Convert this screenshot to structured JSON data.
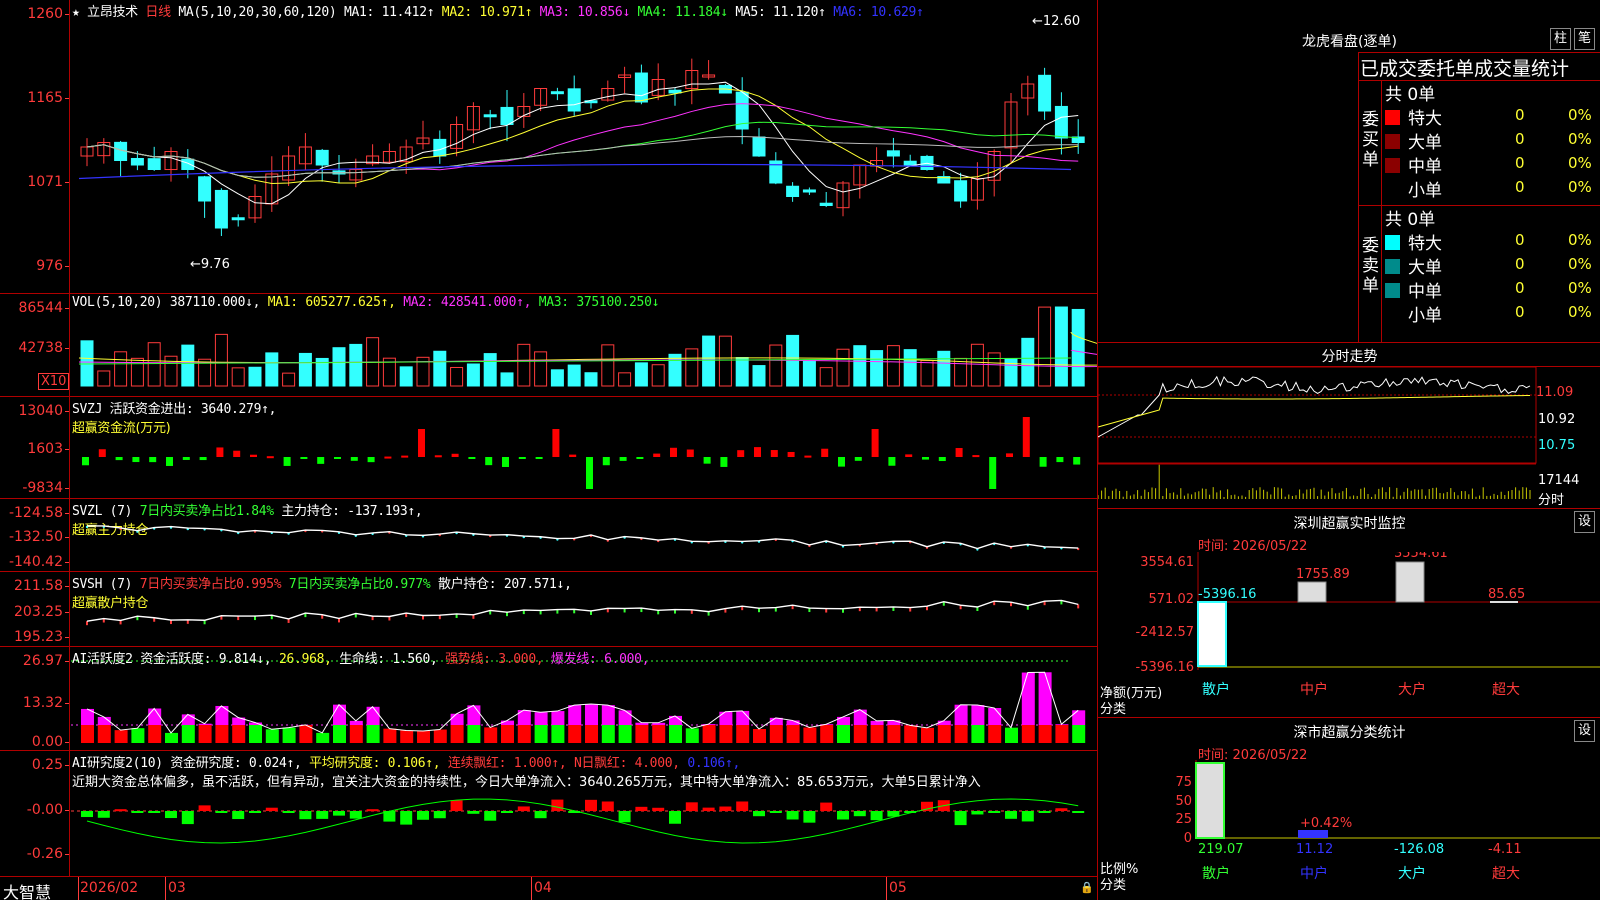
{
  "header": {
    "stock_name": "立昂技术",
    "period": "日线",
    "ma_prefix": "MA(5,10,20,30,60,120)",
    "ma1": "MA1: 11.412↑",
    "ma2": "MA2: 10.971↑",
    "ma3": "MA3: 10.856↓",
    "ma4": "MA4: 11.184↓",
    "ma5": "MA5: 11.120↑",
    "ma6": "MA6: 10.629↑"
  },
  "price_panel": {
    "yticks": [
      "1260",
      "1165",
      "1071",
      "976"
    ],
    "high_marker": "12.60",
    "low_marker": "9.76"
  },
  "vol_panel": {
    "label": "VOL(5,10,20) 387110.000↓,",
    "ma1": "MA1: 605277.625↑,",
    "ma2": "MA2: 428541.000↑,",
    "ma3": "MA3: 375100.250↓",
    "yticks": [
      "86544",
      "42738"
    ],
    "multiplier": "X10"
  },
  "svzj_panel": {
    "label": "SVZJ 活跃资金进出: 3640.279↑,",
    "sub": "超赢资金流(万元)",
    "yticks": [
      "13040",
      "1603",
      "-9834"
    ]
  },
  "svzl_panel": {
    "label_a": "SVZL (7)",
    "label_b": "7日内买卖净占比1.84%",
    "label_c": "主力持仓: -137.193↑,",
    "sub": "超赢主力持仓",
    "yticks": [
      "-124.58",
      "-132.50",
      "-140.42"
    ]
  },
  "svsh_panel": {
    "label_a": "SVSH (7)",
    "label_b": "7日内买卖净占比0.995%",
    "label_c": "7日内买卖净占比0.977%",
    "label_d": "散户持仓: 207.571↓,",
    "sub": "超赢散户持仓",
    "yticks": [
      "211.58",
      "203.25",
      "195.23"
    ]
  },
  "ai_active_panel": {
    "label_a": "AI活跃度2 资金活跃度: 9.814↓,",
    "label_b": "26.968,",
    "label_c": "生命线: 1.560,",
    "label_d": "强势线: 3.000,",
    "label_e": "爆发线: 6.000,",
    "yticks": [
      "26.97",
      "13.32",
      "0.00"
    ]
  },
  "ai_research_panel": {
    "label_a": "AI研究度2(10) 资金研究度: 0.024↑,",
    "label_b": "平均研究度: 0.106↑,",
    "label_c": "连续飘红: 1.000↑,",
    "label_d": "N日飘红: 4.000,",
    "label_e": "0.106↑,",
    "commentary": "近期大资金总体偏多，虽不活跃，但有异动，宜关注大资金的持续性，今日大单净流入：3640.265万元，其中特大单净流入：85.653万元，大单5日累计净入",
    "yticks": [
      "0.25",
      "-0.00",
      "-0.26"
    ]
  },
  "date_axis": {
    "brand": "大智慧",
    "labels": [
      "2026/02",
      "03",
      "04",
      "05"
    ]
  },
  "longhu": {
    "title": "龙虎看盘(逐单)",
    "btn_bar": "柱",
    "btn_pen": "笔",
    "tabs": "已成交委托单成交量统计",
    "buy_label": "委买单",
    "sell_label": "委卖单",
    "buy_total": "共 0单",
    "sell_total": "共 0单",
    "rows": [
      {
        "name": "特大",
        "count": "0",
        "pct": "0%"
      },
      {
        "name": "大单",
        "count": "0",
        "pct": "0%"
      },
      {
        "name": "中单",
        "count": "0",
        "pct": "0%"
      },
      {
        "name": "小单",
        "count": "0",
        "pct": "0%"
      }
    ],
    "colors_buy": [
      "#ff0000",
      "#8b0000",
      "#8b0000",
      "#000000"
    ],
    "colors_sell": [
      "#00ffff",
      "#008b8b",
      "#008b8b",
      "#000000"
    ]
  },
  "intraday": {
    "title": "分时走势",
    "p1": "11.09",
    "p2": "10.92",
    "p3": "10.75",
    "vol": "17144",
    "vol_label": "分时"
  },
  "sz_monitor": {
    "title": "深圳超赢实时监控",
    "btn": "设",
    "time": "时间: 2026/05/22",
    "yticks": [
      "3554.61",
      "571.02",
      "-2412.57",
      "-5396.16"
    ],
    "ylabel_a": "净额(万元)",
    "ylabel_b": "分类",
    "bar_labels": [
      "-5396.16",
      "1755.89",
      "3554.61",
      "85.65"
    ],
    "categories": [
      "散户",
      "中户",
      "大户",
      "超大"
    ]
  },
  "sz_class": {
    "title": "深市超赢分类统计",
    "btn": "设",
    "time": "时间: 2026/05/22",
    "yticks": [
      "75",
      "50",
      "25",
      "0"
    ],
    "ylabel_a": "比例%",
    "ylabel_b": "分类",
    "mid_label": "+0.42%",
    "values": [
      "219.07",
      "11.12",
      "-126.08",
      "-4.11"
    ],
    "categories": [
      "散户",
      "中户",
      "大户",
      "超大"
    ]
  }
}
